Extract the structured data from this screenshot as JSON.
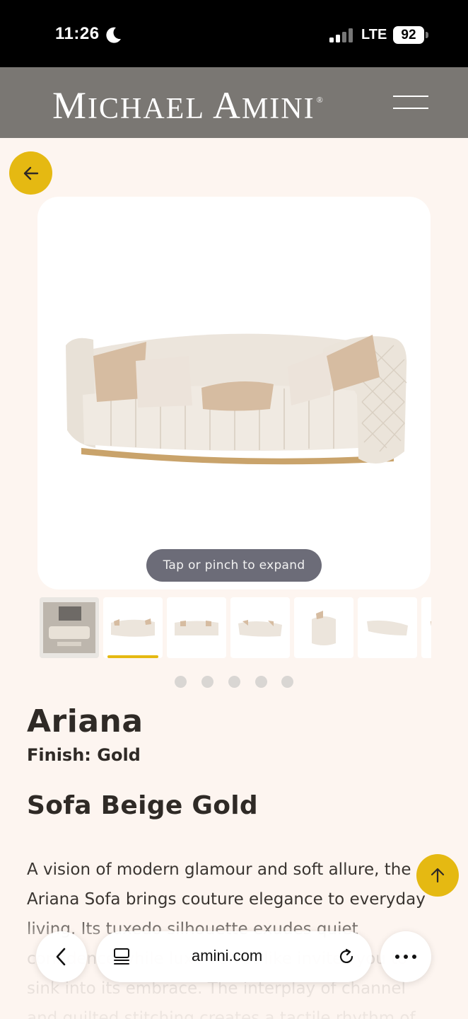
{
  "status_bar": {
    "time": "11:26",
    "network": "LTE",
    "battery": "92",
    "icons": [
      "moon-icon",
      "signal-icon"
    ]
  },
  "header": {
    "logo": {
      "big_m": "M",
      "rest_1": "ICHAEL ",
      "big_a": "A",
      "rest_2": "MINI",
      "mark": "®"
    },
    "menu_icon": "hamburger-icon"
  },
  "gallery": {
    "expand_hint": "Tap or pinch to expand",
    "thumbnail_count": 7,
    "active_thumbnail": 2,
    "dot_count": 5
  },
  "product": {
    "name": "Ariana",
    "finish": "Finish: Gold",
    "title": "Sofa Beige Gold",
    "description": "A vision of modern glamour and soft allure, the Ariana Sofa brings couture elegance to everyday living. Its tuxedo silhouette exudes quiet confidence while luxe velvet-like invites you to sink into its embrace. The interplay of channel and quilted stitching creates a tactile rhythm of"
  },
  "browser": {
    "url": "amini.com",
    "icons": [
      "chevron-left-icon",
      "tabs-icon",
      "reload-icon",
      "more-icon"
    ]
  },
  "colors": {
    "accent": "#e5b912",
    "header_bg": "#7a7773",
    "page_bg": "#fdf5f0",
    "text": "#2f2a26"
  }
}
